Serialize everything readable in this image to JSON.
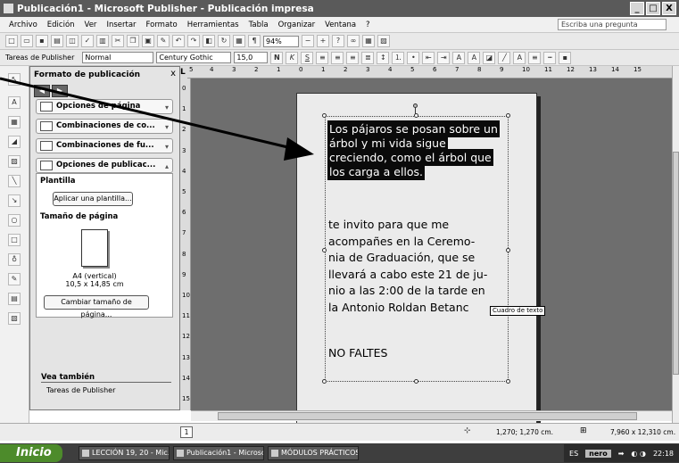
{
  "window": {
    "title": "Publicación1 - Microsoft Publisher - Publicación impresa",
    "min": "_",
    "max": "□",
    "close": "X"
  },
  "menu": {
    "items": [
      "Archivo",
      "Edición",
      "Ver",
      "Insertar",
      "Formato",
      "Herramientas",
      "Tabla",
      "Organizar",
      "Ventana",
      "?"
    ],
    "ask": "Escriba una pregunta"
  },
  "toolbar": {
    "zoom": "94%",
    "publisher_tasks": "Tareas de Publisher",
    "style": "Normal",
    "font": "Century Gothic",
    "size": "15,0"
  },
  "taskpane": {
    "title": "Formato de publicación",
    "close": "x",
    "sections": [
      "Opciones de página",
      "Combinaciones de co...",
      "Combinaciones de fu...",
      "Opciones de publicac..."
    ],
    "plantilla_label": "Plantilla",
    "apply_template": "Aplicar una plantilla...",
    "page_size_label": "Tamaño de página",
    "paper_name": "A4 (vertical)",
    "paper_size": "10,5 x 14,85 cm",
    "change_size": "Cambiar tamaño de página...",
    "see_also": "Vea también",
    "see_also_link": "Tareas de Publisher"
  },
  "ruler": {
    "h_ticks": [
      "5",
      "4",
      "3",
      "2",
      "1",
      "0",
      "1",
      "2",
      "3",
      "4",
      "5",
      "6",
      "7",
      "8",
      "9",
      "10",
      "11",
      "12",
      "13",
      "14",
      "15"
    ],
    "v_ticks": [
      "0",
      "1",
      "2",
      "3",
      "4",
      "5",
      "6",
      "7",
      "8",
      "9",
      "10",
      "11",
      "12",
      "13",
      "14",
      "15"
    ]
  },
  "document": {
    "selected_text": "Los pájaros se posan sobre un árbol y mi vida sigue creciendo, como el árbol que los carga a ellos.",
    "body_lines": [
      "te invito para que me",
      "acompañes en la Ceremo-",
      "nia de Graduación, que se",
      "llevará a cabo este 21 de ju-",
      "nio a las 2:00 de la tarde en",
      "la Antonio Roldan Betanc"
    ],
    "closing": "NO FALTES",
    "tooltip": "Cuadro de texto"
  },
  "status": {
    "page": "1",
    "position": "1,270; 1,270 cm.",
    "size": "7,960 x 12,310 cm."
  },
  "taskbar": {
    "start": "Inicio",
    "tasks": [
      "LECCIÓN 19, 20 - Mic...",
      "Publicación1 - Microso...",
      "MÓDULOS PRÁCTICOS"
    ],
    "lang": "ES",
    "tray_app": "nero",
    "time": "22:18"
  }
}
